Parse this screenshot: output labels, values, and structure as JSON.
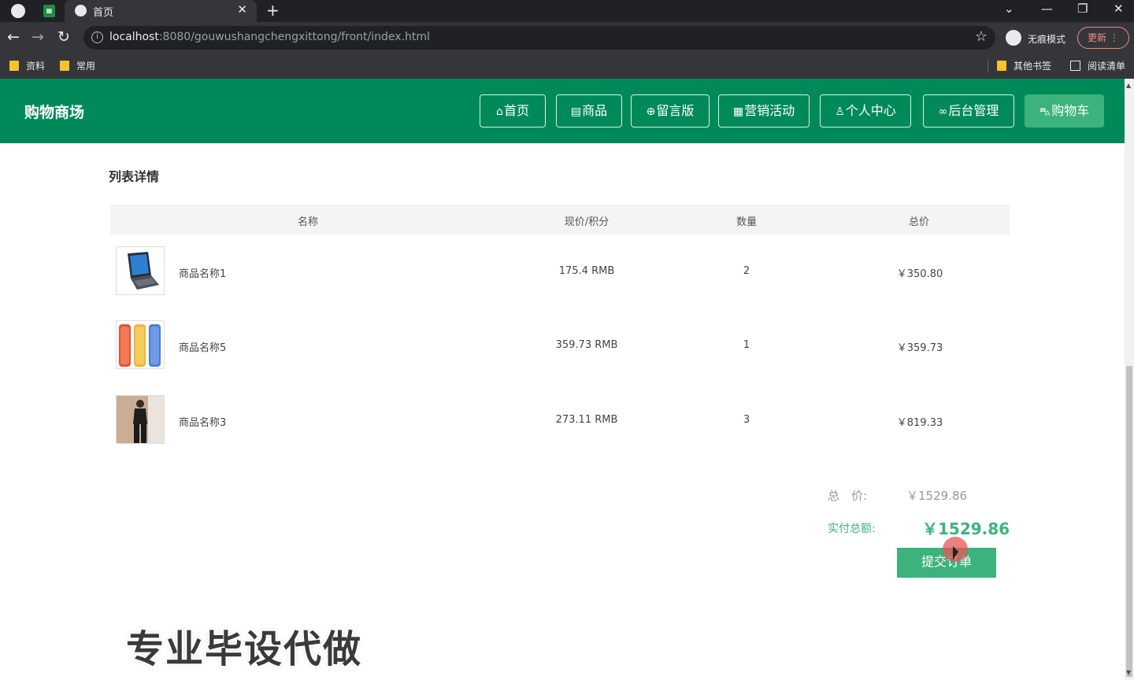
{
  "browser": {
    "tab_title": "首页",
    "tab_close": "✕",
    "new_tab": "+",
    "url_host": "localhost",
    "url_rest": ":8080/gouwushangchengxittong/front/index.html",
    "incognito_label": "无痕模式",
    "update_label": "更新",
    "bookmarks": [
      "资料",
      "常用"
    ],
    "bookmarks_right": [
      "其他书签",
      "阅读清单"
    ]
  },
  "header": {
    "brand": "购物商场",
    "nav": [
      {
        "label": "首页",
        "icon": "home-icon",
        "glyph": "⌂"
      },
      {
        "label": "商品",
        "icon": "calendar-icon",
        "glyph": "▤"
      },
      {
        "label": "留言版",
        "icon": "globe-icon",
        "glyph": "⊕"
      },
      {
        "label": "营销活动",
        "icon": "grid-icon",
        "glyph": "▦"
      },
      {
        "label": "个人中心",
        "icon": "user-icon",
        "glyph": "♙"
      },
      {
        "label": "后台管理",
        "icon": "link-icon",
        "glyph": "∞"
      },
      {
        "label": "购物车",
        "icon": "cart-icon",
        "glyph": "⛍"
      }
    ],
    "active_nav": "购物车"
  },
  "main": {
    "section_title": "列表详情",
    "columns": [
      "名称",
      "现价/积分",
      "数量",
      "总价"
    ],
    "rows": [
      {
        "name": "商品名称1",
        "price": "175.4 RMB",
        "qty": "2",
        "total": "￥350.80",
        "thumb": "laptop"
      },
      {
        "name": "商品名称5",
        "price": "359.73 RMB",
        "qty": "1",
        "total": "￥359.73",
        "thumb": "phones"
      },
      {
        "name": "商品名称3",
        "price": "273.11 RMB",
        "qty": "3",
        "total": "￥819.33",
        "thumb": "clothing"
      }
    ],
    "summary": {
      "total_label": "总　价:",
      "total_value": "￥1529.86",
      "paid_label": "实付总额:",
      "paid_value": "￥1529.86",
      "submit_label": "提交订单"
    }
  },
  "watermark": "专业毕设代做",
  "colors": {
    "brand_green": "#008a5a",
    "accent_green": "#3cb37c"
  }
}
